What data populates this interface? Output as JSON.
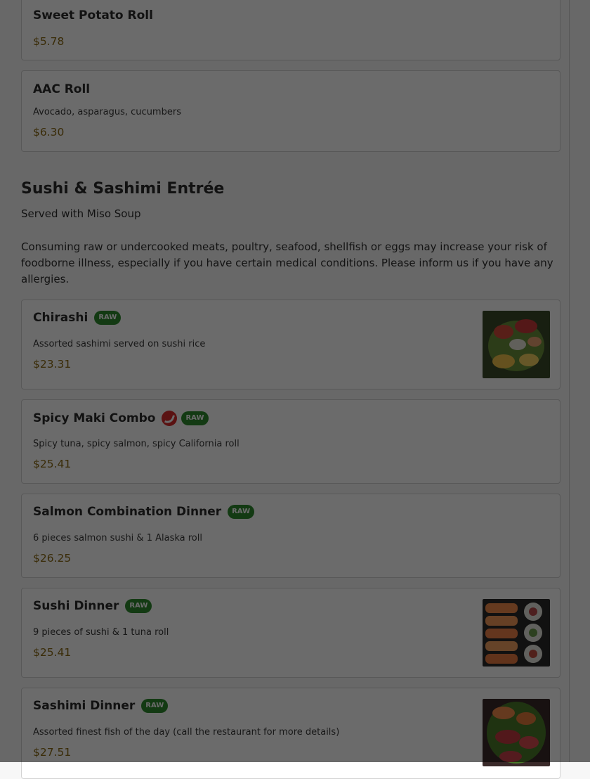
{
  "items_top": [
    {
      "name": "Sweet Potato Roll",
      "price": "$5.78"
    },
    {
      "name": "AAC Roll",
      "description": "Avocado, asparagus, cucumbers",
      "price": "$6.30"
    }
  ],
  "section": {
    "title": "Sushi & Sashimi Entrée",
    "subtitle": "Served with Miso Soup",
    "notice": "Consuming raw or undercooked meats, poultry, seafood, shellfish or eggs may increase your risk of foodborne illness, especially if you have certain medical conditions. Please inform us if you have any allergies."
  },
  "badge_raw": "RAW",
  "items": [
    {
      "name": "Chirashi",
      "description": "Assorted sashimi served on sushi rice",
      "price": "$23.31"
    },
    {
      "name": "Spicy Maki Combo",
      "description": "Spicy tuna, spicy salmon, spicy California roll",
      "price": "$25.41"
    },
    {
      "name": "Salmon Combination Dinner",
      "description": "6 pieces salmon sushi & 1 Alaska roll",
      "price": "$26.25"
    },
    {
      "name": "Sushi Dinner",
      "description": "9 pieces of sushi & 1 tuna roll",
      "price": "$25.41"
    },
    {
      "name": "Sashimi Dinner",
      "description": "Assorted finest fish of the day (call the restaurant for more details)",
      "price": "$27.51"
    }
  ],
  "colors": {
    "price": "#8a6914",
    "raw_badge": "#2f8a2f",
    "spicy_badge": "#d62b2b"
  }
}
